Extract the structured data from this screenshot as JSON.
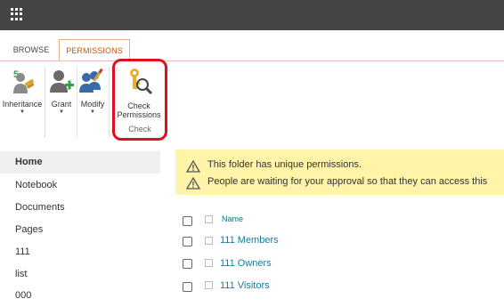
{
  "ribbon": {
    "tabs": [
      {
        "label": "BROWSE"
      },
      {
        "label": "PERMISSIONS"
      }
    ],
    "buttons": {
      "inheritance": "Inheritance",
      "grant": "Grant",
      "modify": "Modify",
      "check_line1": "Check",
      "check_line2": "Permissions"
    },
    "group_label": "Check"
  },
  "nav": {
    "items": [
      {
        "label": "Home"
      },
      {
        "label": "Notebook"
      },
      {
        "label": "Documents"
      },
      {
        "label": "Pages"
      },
      {
        "label": "111"
      },
      {
        "label": "list"
      },
      {
        "label": "000"
      }
    ]
  },
  "banner": {
    "line1": "This folder has unique permissions.",
    "line2": "People are waiting for your approval so that they can access this"
  },
  "list": {
    "header": "Name",
    "rows": [
      {
        "name": "111 Members"
      },
      {
        "name": "111 Owners"
      },
      {
        "name": "111 Visitors"
      }
    ]
  },
  "colors": {
    "topbar": "#444444",
    "accent": "#c65a11",
    "highlight": "#e0101e",
    "banner_bg": "#fff4a8",
    "link": "#1a7a99"
  }
}
